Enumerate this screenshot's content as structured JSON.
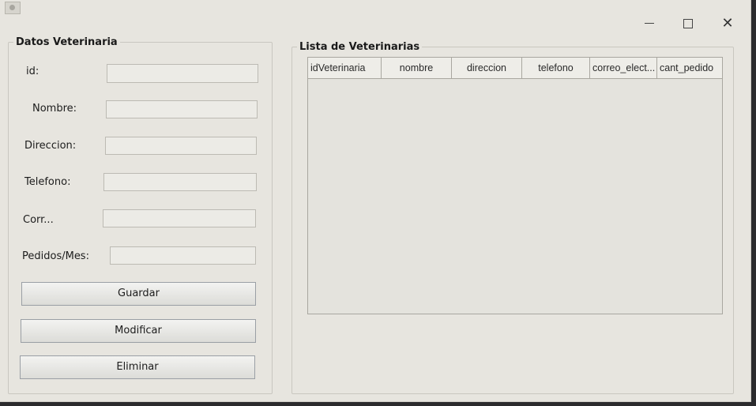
{
  "window": {
    "close_symbol": "✕"
  },
  "datos": {
    "legend": "Datos Veterinaria",
    "fields": [
      {
        "label": "id:",
        "value": ""
      },
      {
        "label": "Nombre:",
        "value": ""
      },
      {
        "label": "Direccion:",
        "value": ""
      },
      {
        "label": "Telefono:",
        "value": ""
      },
      {
        "label": "Corr...",
        "value": ""
      },
      {
        "label": "Pedidos/Mes:",
        "value": ""
      }
    ],
    "buttons": {
      "guardar": "Guardar",
      "modificar": "Modificar",
      "eliminar": "Eliminar"
    }
  },
  "lista": {
    "legend": "Lista de Veterinarias",
    "columns": [
      "idVeterinaria",
      "nombre",
      "direccion",
      "telefono",
      "correo_elect...",
      "cant_pedido"
    ],
    "rows": []
  },
  "icons": {
    "app": "java-cup-icon",
    "minimize": "minimize-icon",
    "maximize": "maximize-icon",
    "close": "close-icon"
  }
}
